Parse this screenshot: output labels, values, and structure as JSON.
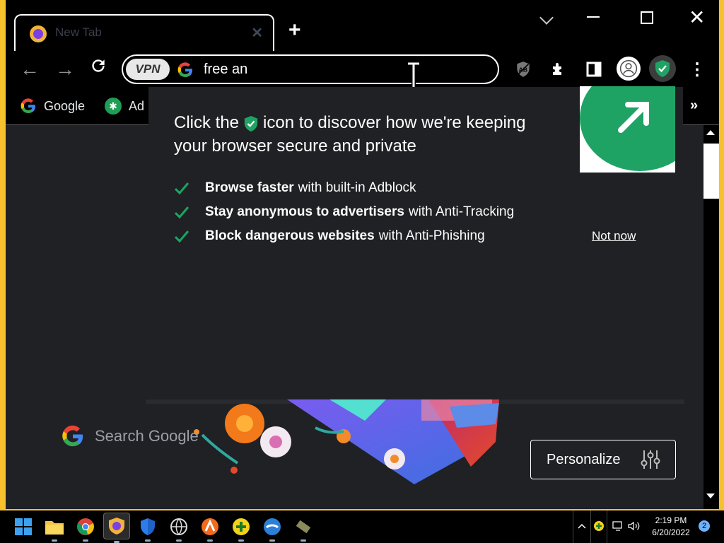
{
  "tab": {
    "title": "New Tab"
  },
  "omnibox": {
    "vpn_label": "VPN",
    "value": "free an"
  },
  "bookmarks": [
    {
      "label": "Google"
    },
    {
      "label": "Ad"
    }
  ],
  "popup": {
    "title_part1": "Click the",
    "title_part2": "icon to discover how we're keeping your browser secure and private",
    "features": [
      {
        "bold": "Browse faster",
        "rest": "with built-in Adblock"
      },
      {
        "bold": "Stay anonymous to advertisers",
        "rest": "with Anti-Tracking"
      },
      {
        "bold": "Block dangerous websites",
        "rest": "with Anti-Phishing"
      }
    ],
    "dismiss_label": "Not now"
  },
  "search": {
    "placeholder": "Search Google"
  },
  "personalize": {
    "label": "Personalize"
  },
  "clock": {
    "time": "2:19 PM",
    "date": "6/20/2022"
  },
  "notifications": {
    "count": "2"
  },
  "colors": {
    "accent_green": "#1fa365",
    "taskbar_border": "#f6c12c"
  }
}
